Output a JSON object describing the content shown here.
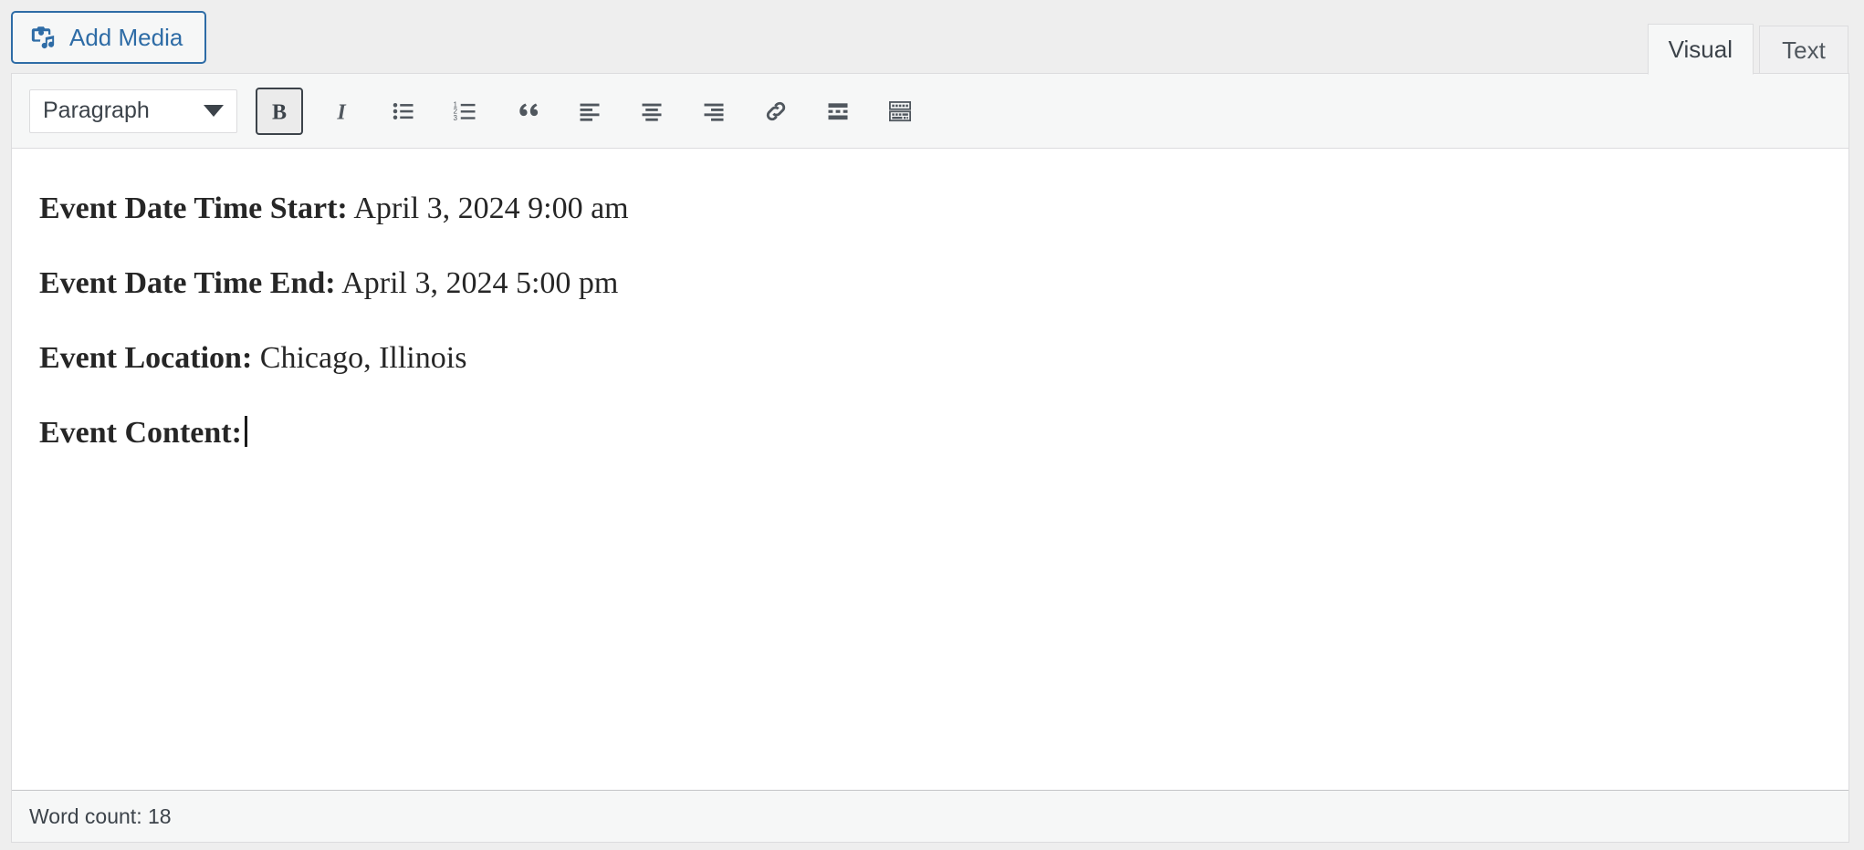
{
  "toolbar_top": {
    "add_media_label": "Add Media",
    "add_media_icon": "camera-music-icon"
  },
  "editor_tabs": [
    {
      "label": "Visual",
      "active": true
    },
    {
      "label": "Text",
      "active": false
    }
  ],
  "format_toolbar": {
    "format_select_value": "Paragraph",
    "buttons": [
      {
        "name": "bold-button",
        "title": "Bold",
        "active": true
      },
      {
        "name": "italic-button",
        "title": "Italic",
        "active": false
      },
      {
        "name": "bulleted-list-button",
        "title": "Bulleted list",
        "active": false
      },
      {
        "name": "numbered-list-button",
        "title": "Numbered list",
        "active": false
      },
      {
        "name": "blockquote-button",
        "title": "Blockquote",
        "active": false
      },
      {
        "name": "align-left-button",
        "title": "Align left",
        "active": false
      },
      {
        "name": "align-center-button",
        "title": "Align center",
        "active": false
      },
      {
        "name": "align-right-button",
        "title": "Align right",
        "active": false
      },
      {
        "name": "insert-link-button",
        "title": "Insert/edit link",
        "active": false
      },
      {
        "name": "read-more-button",
        "title": "Insert Read More tag",
        "active": false
      },
      {
        "name": "toolbar-toggle-button",
        "title": "Toolbar Toggle",
        "active": false
      }
    ]
  },
  "content": {
    "lines": [
      {
        "label": "Event Date Time Start:",
        "value": " April 3, 2024 9:00 am",
        "cursor": false
      },
      {
        "label": "Event Date Time End:",
        "value": " April 3, 2024 5:00 pm",
        "cursor": false
      },
      {
        "label": "Event Location:",
        "value": " Chicago, Illinois",
        "cursor": false
      },
      {
        "label": "Event Content:",
        "value": "",
        "cursor": true
      }
    ]
  },
  "status": {
    "word_count_label": "Word count: 18"
  },
  "colors": {
    "accent_blue": "#2e6ca6",
    "toolbar_bg": "#f6f7f7",
    "page_bg": "#eeeeee",
    "border": "#dcdcde",
    "icon": "#50575e",
    "text": "#3c434a"
  }
}
